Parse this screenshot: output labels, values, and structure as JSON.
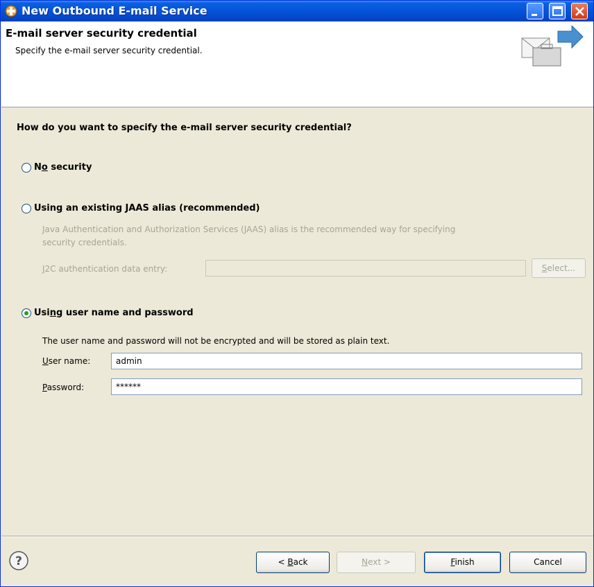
{
  "window": {
    "title": "New Outbound E-mail Service",
    "icon": "eclipse-plug-icon"
  },
  "banner": {
    "title": "E-mail server security credential",
    "description": "Specify the e-mail server security credential.",
    "graphic": "email-outbound-graphic"
  },
  "question": "How do you want to specify the e-mail server security credential?",
  "options": {
    "no_security": {
      "label_pre": "N",
      "label_mnemonic": "o",
      "label_post": " security",
      "selected": false
    },
    "jaas": {
      "label_pre": "Usin",
      "label_mnemonic": "g",
      "label_post": " an existing JAAS alias (recommended)",
      "selected": false,
      "description_line1": "Java Authentication and Authorization Services (JAAS) alias is the recommended way for specifying",
      "description_line2": "security credentials.",
      "j2c_label_mnemonic": "J",
      "j2c_label_rest": "2C authentication data entry:",
      "j2c_value": "",
      "select_mnemonic": "S",
      "select_rest": "elect..."
    },
    "user_password": {
      "label_pre": "Usi",
      "label_mnemonic": "n",
      "label_post": "g user name and password",
      "selected": true,
      "note": "The user name and password will not be encrypted and will be stored as plain text.",
      "username_label_mnemonic": "U",
      "username_label_rest": "ser name:",
      "username_value": "admin",
      "password_label_mnemonic": "P",
      "password_label_rest": "assword:",
      "password_value": "******"
    }
  },
  "footer": {
    "back_pre": "< ",
    "back_mnemonic": "B",
    "back_rest": "ack",
    "next_mnemonic": "N",
    "next_rest": "ext >",
    "finish_mnemonic": "F",
    "finish_rest": "inish",
    "cancel": "Cancel"
  }
}
